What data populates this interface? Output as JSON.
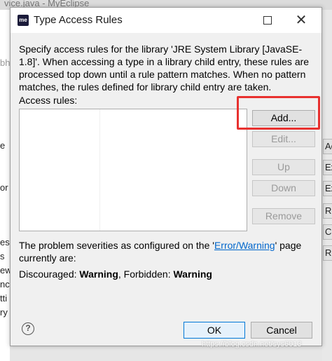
{
  "background": {
    "title_fragment": "vice.java - MyEclipse",
    "left_fragments": [
      "bh",
      "e",
      "or",
      "es",
      "s",
      "ew",
      "nc",
      "tti",
      "ry"
    ],
    "right_fragments": [
      "Ac",
      "Ex",
      "Ex",
      "Re",
      "Cl",
      "Re"
    ]
  },
  "dialog": {
    "app_icon_text": "me",
    "title": "Type Access Rules",
    "description": "Specify access rules for the library 'JRE System Library [JavaSE-1.8]'. When accessing a type in a library child entry, these rules are processed top down until a rule pattern matches. When no pattern matches, the rules defined for library child entry are taken.",
    "rules_label": "Access rules:",
    "buttons": {
      "add": "Add...",
      "edit": "Edit...",
      "up": "Up",
      "down": "Down",
      "remove": "Remove",
      "ok": "OK",
      "cancel": "Cancel"
    },
    "severity": {
      "prefix": "The problem severities as configured on the '",
      "link": "Error/Warning",
      "suffix": "' page currently are:",
      "discouraged_label": "Discouraged: ",
      "discouraged_value": "Warning",
      "separator": ", Forbidden: ",
      "forbidden_value": "Warning"
    },
    "help_symbol": "?"
  },
  "watermark": "https://blog.csdn.net/sys6013",
  "colors": {
    "highlight": "#e8312f",
    "link": "#0066cc",
    "focus": "#0078d7"
  }
}
